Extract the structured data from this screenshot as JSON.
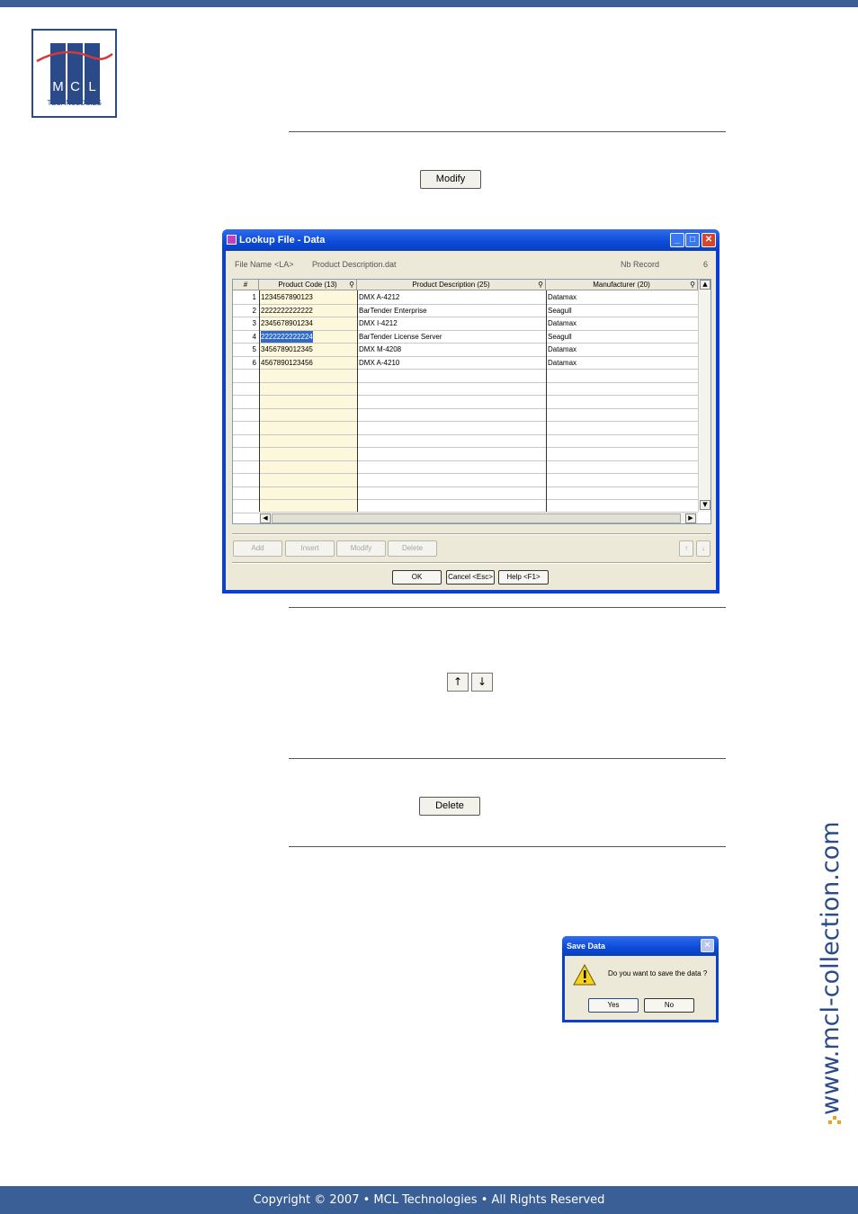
{
  "logo": {
    "letters": [
      "M",
      "C",
      "L"
    ],
    "subtitle": "TECHNOLOGIES"
  },
  "buttons": {
    "modify": "Modify",
    "up_arrow": "↑",
    "down_arrow": "↓",
    "delete": "Delete"
  },
  "lookup_window": {
    "title": "Lookup File - Data",
    "file_name_label": "File Name",
    "file_name_prefix": "<LA>",
    "file_name_value": "Product Description.dat",
    "nb_record_label": "Nb Record",
    "nb_record_value": "6",
    "columns": [
      "#",
      "Product Code (13)",
      "Product Description (25)",
      "Manufacturer (20)"
    ],
    "rows": [
      {
        "num": "1",
        "code": "1234567890123",
        "desc": "DMX A-4212",
        "mfr": "Datamax"
      },
      {
        "num": "2",
        "code": "2222222222222",
        "desc": "BarTender Enterprise",
        "mfr": "Seagull"
      },
      {
        "num": "3",
        "code": "2345678901234",
        "desc": "DMX I-4212",
        "mfr": "Datamax"
      },
      {
        "num": "4",
        "code": "2222222222224",
        "desc": "BarTender License Server",
        "mfr": "Seagull"
      },
      {
        "num": "5",
        "code": "3456789012345",
        "desc": "DMX M-4208",
        "mfr": "Datamax"
      },
      {
        "num": "6",
        "code": "4567890123456",
        "desc": "DMX A-4210",
        "mfr": "Datamax"
      }
    ],
    "selected_row": 4,
    "action_buttons": [
      "Add",
      "Insert",
      "Modify",
      "Delete"
    ],
    "nav_buttons": [
      "↑",
      "↓"
    ],
    "ok": "OK",
    "cancel": "Cancel <Esc>",
    "help": "Help <F1>"
  },
  "save_dialog": {
    "title": "Save Data",
    "message": "Do you want to save the data ?",
    "yes": "Yes",
    "no": "No"
  },
  "side_url": "www.mcl-collection.com",
  "footer": "Copyright © 2007 • MCL Technologies • All Rights Reserved",
  "colors": {
    "brand_blue": "#3a5f96",
    "selection": "#316ac5",
    "highlight_column": "#fdf8dc"
  }
}
